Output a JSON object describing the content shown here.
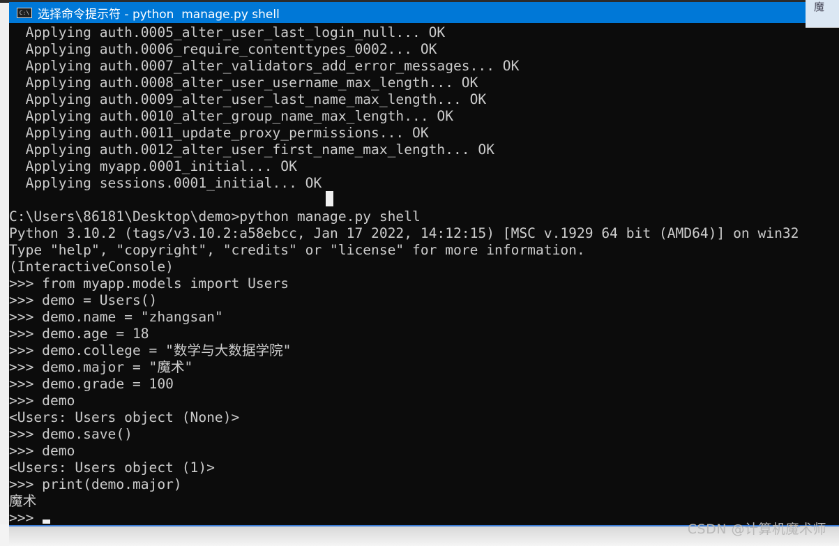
{
  "window": {
    "title": "选择命令提示符 - python  manage.py shell",
    "icon": "cmd-icon"
  },
  "corner_fragment": "魔",
  "console_lines": [
    "  Applying auth.0005_alter_user_last_login_null... OK",
    "  Applying auth.0006_require_contenttypes_0002... OK",
    "  Applying auth.0007_alter_validators_add_error_messages... OK",
    "  Applying auth.0008_alter_user_username_max_length... OK",
    "  Applying auth.0009_alter_user_last_name_max_length... OK",
    "  Applying auth.0010_alter_group_name_max_length... OK",
    "  Applying auth.0011_update_proxy_permissions... OK",
    "  Applying auth.0012_alter_user_first_name_max_length... OK",
    "  Applying myapp.0001_initial... OK",
    "  Applying sessions.0001_initial... OK",
    "",
    "C:\\Users\\86181\\Desktop\\demo>python manage.py shell",
    "Python 3.10.2 (tags/v3.10.2:a58ebcc, Jan 17 2022, 14:12:15) [MSC v.1929 64 bit (AMD64)] on win32",
    "Type \"help\", \"copyright\", \"credits\" or \"license\" for more information.",
    "(InteractiveConsole)",
    ">>> from myapp.models import Users",
    ">>> demo = Users()",
    ">>> demo.name = \"zhangsan\"",
    ">>> demo.age = 18",
    ">>> demo.college = \"数学与大数据学院\"",
    ">>> demo.major = \"魔术\"",
    ">>> demo.grade = 100",
    ">>> demo",
    "<Users: Users object (None)>",
    ">>> demo.save()",
    ">>> demo",
    "<Users: Users object (1)>",
    ">>> print(demo.major)",
    "魔术",
    ">>> "
  ],
  "watermark": "CSDN @计算机魔术师",
  "colors": {
    "titlebar": "#0078d7",
    "console_bg": "#0c0c0c",
    "console_text": "#cccccc"
  }
}
